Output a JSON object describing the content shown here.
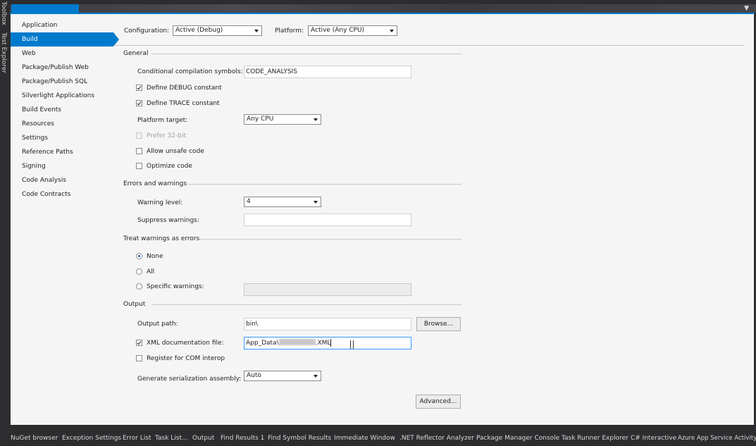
{
  "side_tabs": [
    "Toolbox",
    "Test Explorer"
  ],
  "title_menu_glyph": "▼",
  "nav": {
    "items": [
      "Application",
      "Build",
      "Web",
      "Package/Publish Web",
      "Package/Publish SQL",
      "Silverlight Applications",
      "Build Events",
      "Resources",
      "Settings",
      "Reference Paths",
      "Signing",
      "Code Analysis",
      "Code Contracts"
    ],
    "active_index": 1
  },
  "config": {
    "configuration_label": "Configuration:",
    "configuration_value": "Active (Debug)",
    "platform_label": "Platform:",
    "platform_value": "Active (Any CPU)"
  },
  "general": {
    "header": "General",
    "conditional_label": "Conditional compilation symbols:",
    "conditional_value": "CODE_ANALYSIS",
    "define_debug": {
      "label": "Define DEBUG constant",
      "checked": true
    },
    "define_trace": {
      "label": "Define TRACE constant",
      "checked": true
    },
    "platform_target_label": "Platform target:",
    "platform_target_value": "Any CPU",
    "prefer32": {
      "label": "Prefer 32-bit",
      "checked": false,
      "disabled": true
    },
    "allow_unsafe": {
      "label": "Allow unsafe code",
      "checked": false
    },
    "optimize": {
      "label": "Optimize code",
      "checked": false
    }
  },
  "errors": {
    "header": "Errors and warnings",
    "warning_level_label": "Warning level:",
    "warning_level_value": "4",
    "suppress_label": "Suppress warnings:",
    "suppress_value": ""
  },
  "treat": {
    "header": "Treat warnings as errors",
    "none_label": "None",
    "all_label": "All",
    "specific_label": "Specific warnings:",
    "selected": "None"
  },
  "output": {
    "header": "Output",
    "path_label": "Output path:",
    "path_value": "bin\\",
    "browse_label": "Browse...",
    "xml_label": "XML documentation file:",
    "xml_checked": true,
    "xml_value_prefix": "App_Data\\",
    "xml_value_suffix": ".XML",
    "com_label": "Register for COM interop",
    "serialization_label": "Generate serialization assembly:",
    "serialization_value": "Auto",
    "advanced_label": "Advanced..."
  },
  "bottom_tabs": [
    "NuGet browser",
    "Exception Settings",
    "Error List",
    "Task List...",
    "Output",
    "Find Results 1",
    "Find Symbol Results",
    "Immediate Window",
    ".NET Reflector Analyzer",
    "Package Manager Console",
    "Task Runner Explorer",
    "C# Interactive",
    "Azure App Service Activity"
  ],
  "colors": {
    "accent": "#007acc",
    "chrome": "#2d2d30",
    "panel": "#f5f5f5"
  }
}
